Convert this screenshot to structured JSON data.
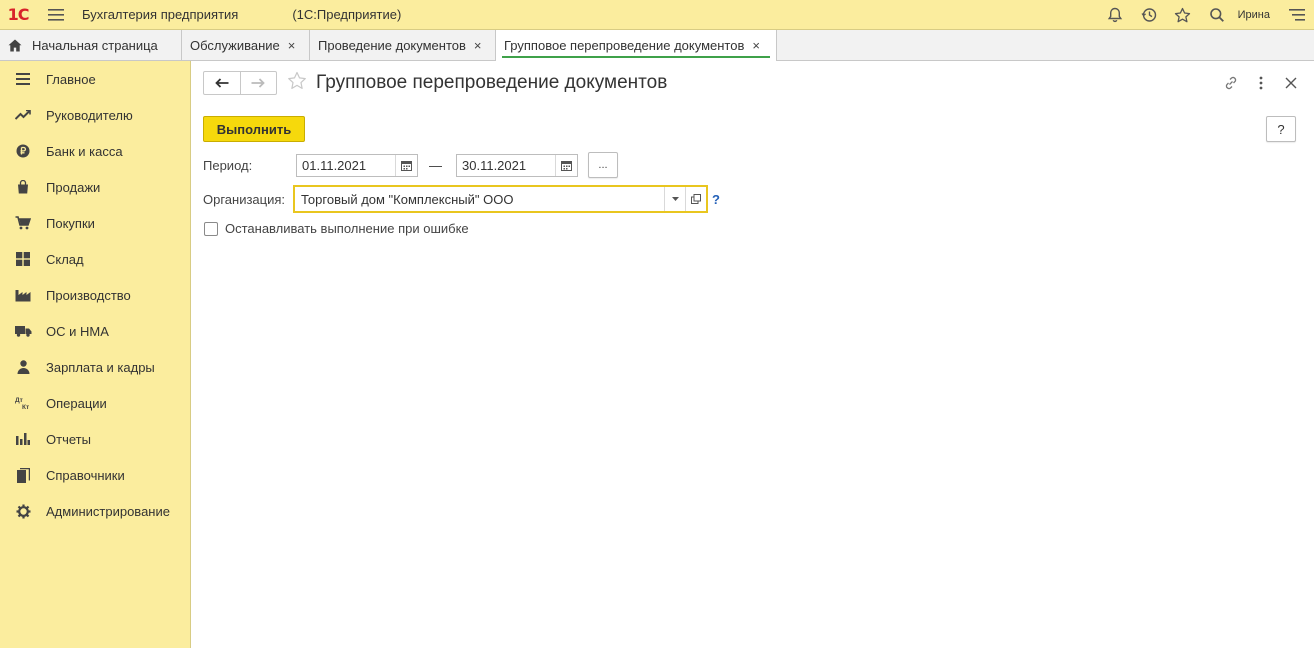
{
  "app": {
    "logo": "1С",
    "title": "Бухгалтерия предприятия",
    "subtitle": "(1С:Предприятие)",
    "user": "Ирина"
  },
  "tabs": [
    {
      "label": "Начальная страница",
      "icon": "home-icon"
    },
    {
      "label": "Обслуживание",
      "close": "×"
    },
    {
      "label": "Проведение документов",
      "close": "×"
    },
    {
      "label": "Групповое перепроведение документов",
      "close": "×",
      "active": true
    }
  ],
  "sidebar": {
    "items": [
      {
        "label": "Главное",
        "icon": "menu-lines-icon"
      },
      {
        "label": "Руководителю",
        "icon": "trend-icon"
      },
      {
        "label": "Банк и касса",
        "icon": "ruble-coin-icon"
      },
      {
        "label": "Продажи",
        "icon": "shopping-bag-icon"
      },
      {
        "label": "Покупки",
        "icon": "cart-icon"
      },
      {
        "label": "Склад",
        "icon": "warehouse-grid-icon"
      },
      {
        "label": "Производство",
        "icon": "factory-icon"
      },
      {
        "label": "ОС и НМА",
        "icon": "truck-icon"
      },
      {
        "label": "Зарплата и кадры",
        "icon": "person-icon"
      },
      {
        "label": "Операции",
        "icon": "dt-kt-icon"
      },
      {
        "label": "Отчеты",
        "icon": "bar-chart-icon"
      },
      {
        "label": "Справочники",
        "icon": "books-icon"
      },
      {
        "label": "Администрирование",
        "icon": "gear-icon"
      }
    ]
  },
  "form": {
    "title": "Групповое перепроведение документов",
    "execute_label": "Выполнить",
    "help_label": "?",
    "period_label": "Период:",
    "date_from": "01.11.2021",
    "date_dash": "—",
    "date_to": "30.11.2021",
    "dots_label": "...",
    "org_label": "Организация:",
    "org_value": "Торговый дом \"Комплексный\" ООО",
    "org_help": "?",
    "stop_on_error_label": "Останавливать выполнение при ошибке",
    "stop_on_error_checked": false
  },
  "colors": {
    "topbar": "#fbed9e",
    "sidebar": "#fbed9e",
    "execute_button": "#f6d90c",
    "active_tab_underline": "#3fa14a",
    "org_field_border": "#e9c61f",
    "logo_red": "#d8232a"
  }
}
